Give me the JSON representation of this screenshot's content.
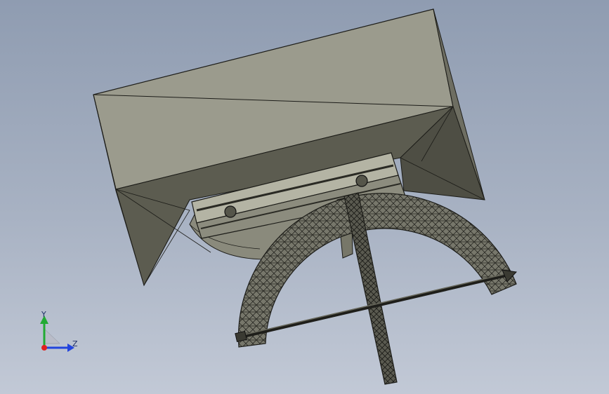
{
  "viewport": {
    "triad": {
      "y_label": "Y",
      "z_label": "Z"
    },
    "colors": {
      "background_top": "#8f9cb1",
      "background_bottom": "#c2c9d6",
      "model_light": "#9a9a8c",
      "model_dark": "#4a4a40",
      "model_edge": "#1c1c18",
      "axis_x": "#e02020",
      "axis_y": "#22aa33",
      "axis_z": "#2244dd"
    }
  }
}
